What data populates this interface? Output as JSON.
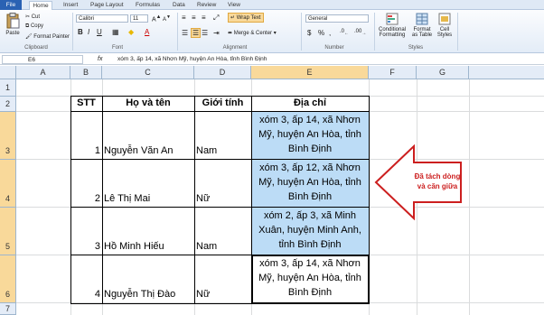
{
  "ribbon_tabs": [
    "File",
    "Home",
    "Insert",
    "Page Layout",
    "Formulas",
    "Data",
    "Review",
    "View"
  ],
  "clipboard": {
    "paste": "Paste",
    "cut": "Cut",
    "copy": "Copy",
    "format_painter": "Format Painter",
    "label": "Clipboard"
  },
  "font": {
    "name": "Calibri",
    "size": "11",
    "label": "Font"
  },
  "alignment": {
    "wrap": "Wrap Text",
    "merge": "Merge & Center",
    "label": "Alignment"
  },
  "number": {
    "format": "General",
    "label": "Number",
    "pct": "%",
    "comma": ","
  },
  "styles": {
    "conditional": "Conditional",
    "conditional2": "Formatting",
    "format_as": "Format",
    "format_as2": "as Table",
    "cell": "Cell",
    "cell2": "Styles",
    "label": "Styles"
  },
  "formula_bar": {
    "name_box": "E6",
    "fx": "fx",
    "content": "xóm 3, ấp 14, xã Nhơn Mỹ, huyện An Hòa, tỉnh Bình Định"
  },
  "columns": [
    "A",
    "B",
    "C",
    "D",
    "E",
    "F",
    "G"
  ],
  "rows": [
    "1",
    "2",
    "3",
    "4",
    "5",
    "6",
    "7"
  ],
  "table": {
    "headers": {
      "stt": "STT",
      "name": "Họ và tên",
      "gender": "Giới tính",
      "address": "Địa chỉ"
    },
    "records": [
      {
        "stt": "1",
        "name": "Nguyễn Văn An",
        "gender": "Nam",
        "addr1": "xóm 3, ấp 14, xã Nhơn",
        "addr2": "Mỹ, huyện An Hòa, tỉnh",
        "addr3": "Bình Định"
      },
      {
        "stt": "2",
        "name": "Lê Thị Mai",
        "gender": "Nữ",
        "addr1": "xóm 3, ấp 12, xã Nhơn",
        "addr2": "Mỹ, huyện An Hòa, tỉnh",
        "addr3": "Bình Định"
      },
      {
        "stt": "3",
        "name": "Hồ Minh Hiếu",
        "gender": "Nam",
        "addr1": "xóm 2, ấp 3, xã Minh",
        "addr2": "Xuân, huyện Minh Anh,",
        "addr3": "tỉnh Bình Định"
      },
      {
        "stt": "4",
        "name": "Nguyễn Thị Đào",
        "gender": "Nữ",
        "addr1": "xóm 3, ấp 14, xã Nhơn",
        "addr2": "Mỹ, huyện An Hòa, tỉnh",
        "addr3": "Bình Định"
      }
    ]
  },
  "callout": {
    "line1": "Đã tách dòng",
    "line2": "và căn giữa",
    "color": "#cc1f1f"
  }
}
